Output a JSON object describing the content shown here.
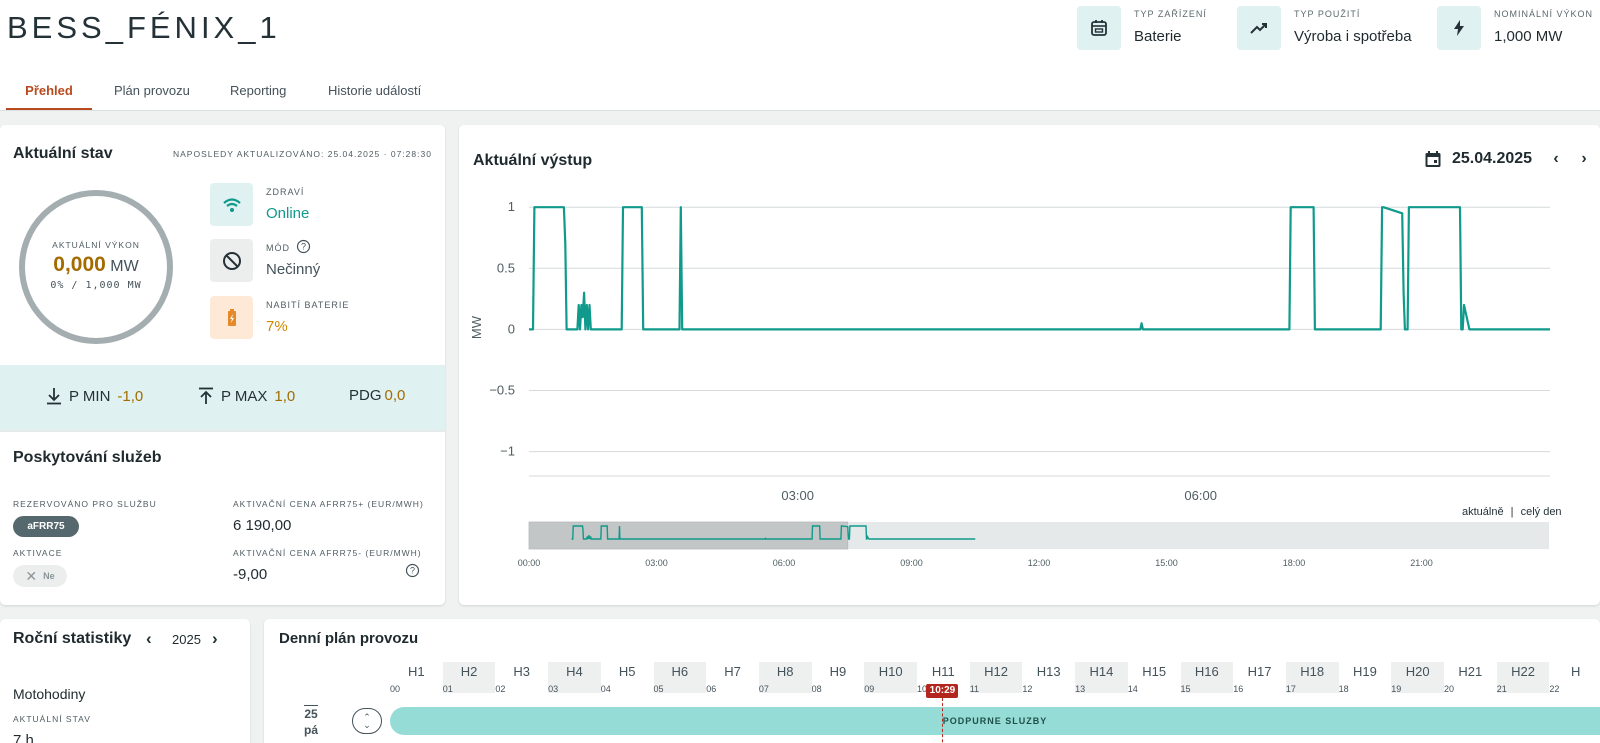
{
  "device": {
    "name": "BESS_FÉNIX_1",
    "info": [
      {
        "label": "TYP ZAŘÍZENÍ",
        "value": "Baterie",
        "icon": "calendar-box-icon"
      },
      {
        "label": "TYP POUŽITÍ",
        "value": "Výroba i spotřeba",
        "icon": "trending-up-icon"
      },
      {
        "label": "NOMINÁLNÍ VÝKON",
        "value": "1,000 MW",
        "icon": "lightning-icon"
      }
    ]
  },
  "tabs": [
    "Přehled",
    "Plán provozu",
    "Reporting",
    "Historie událostí"
  ],
  "active_tab": "Přehled",
  "status": {
    "title": "Aktuální stav",
    "updated": "NAPOSLEDY AKTUALIZOVÁNO: 25.04.2025 · 07:28:30",
    "gauge_label": "AKTUÁLNÍ VÝKON",
    "power_value": "0,000",
    "power_unit": "MW",
    "power_sub": "0% / 1,000 MW",
    "health_label": "ZDRAVÍ",
    "health_value": "Online",
    "mode_label": "MÓD",
    "mode_value": "Nečinný",
    "battery_label": "NABITÍ BATERIE",
    "battery_value": "7%",
    "pmin_label": "P MIN",
    "pmin_value": "-1,0",
    "pmax_label": "P MAX",
    "pmax_value": "1,0",
    "pdg_label": "PDG",
    "pdg_value": "0,0"
  },
  "services": {
    "title": "Poskytování služeb",
    "reserved_label": "REZERVOVÁNO PRO SLUŽBU",
    "reserved_chip": "aFRR75",
    "activation_label": "AKTIVACE",
    "activation_chip": "Ne",
    "price_plus_label": "AKTIVAČNÍ CENA AFRR75+ (EUR/MWH)",
    "price_plus_value": "6 190,00",
    "price_minus_label": "AKTIVAČNÍ CENA AFRR75- (EUR/MWH)",
    "price_minus_value": "-9,00"
  },
  "output": {
    "title": "Aktuální výstup",
    "date": "25.04.2025",
    "view_current": "aktuálně",
    "view_separator": "|",
    "view_full": "celý den"
  },
  "chart_data": {
    "type": "line",
    "title": "Aktuální výstup",
    "ylabel": "MW",
    "ylim": [
      -1.2,
      1.1
    ],
    "y_ticks": [
      "1",
      "0.5",
      "0",
      "−0.5",
      "−1"
    ],
    "y_tick_values": [
      1,
      0.5,
      0,
      -0.5,
      -1
    ],
    "x_ticks": [
      "03:00",
      "06:00"
    ],
    "x_tick_values": [
      3,
      6
    ],
    "xlim": [
      1.0,
      8.6
    ],
    "grid": true,
    "color": "#0f9a8c",
    "series": [
      {
        "x": [
          1.0,
          1.03,
          1.04,
          1.26,
          1.27,
          1.28,
          1.3,
          1.31,
          1.32,
          1.36,
          1.37,
          1.38,
          1.39,
          1.4,
          1.41,
          1.42,
          1.43,
          1.44,
          1.45,
          1.46,
          1.47,
          1.48,
          1.49,
          1.5,
          1.51,
          1.52,
          1.53,
          1.54,
          1.69,
          1.7,
          1.71,
          1.84,
          1.85,
          1.86,
          2.12,
          2.13,
          2.14,
          2.15,
          2.16,
          2.17,
          2.18,
          2.19,
          2.2,
          2.21,
          5.55,
          5.56,
          5.57,
          5.58,
          6.65,
          6.66,
          6.67,
          6.68,
          6.84,
          6.85,
          6.86,
          7.34,
          7.35,
          7.36,
          7.5,
          7.51,
          7.52,
          7.53,
          7.54,
          7.55,
          7.56,
          7.63,
          7.64,
          7.65,
          7.93,
          7.94,
          7.95,
          7.96,
          8.0,
          8.01,
          8.02,
          8.6
        ],
        "y": [
          0,
          0,
          1,
          1,
          0.7,
          0,
          0,
          0,
          0,
          0,
          0.2,
          0,
          0.2,
          0.1,
          0.3,
          0,
          0.2,
          0,
          0.2,
          0,
          0,
          0,
          0,
          0,
          0,
          0,
          0,
          0,
          0,
          1,
          1,
          1,
          0,
          0,
          0,
          1,
          0,
          0,
          0,
          0,
          0,
          0,
          0,
          0,
          0,
          0.05,
          0,
          0,
          0,
          0,
          1,
          1,
          1,
          0,
          0,
          0,
          1,
          1,
          0.95,
          0.3,
          0,
          0,
          0,
          1,
          1,
          1,
          1,
          1,
          1,
          0,
          0,
          0.2,
          0,
          0,
          0,
          0
        ]
      }
    ]
  },
  "navigator": {
    "ticks": [
      "00:00",
      "03:00",
      "06:00",
      "09:00",
      "12:00",
      "15:00",
      "18:00",
      "21:00"
    ],
    "tick_values": [
      0,
      3,
      6,
      9,
      12,
      15,
      18,
      21
    ],
    "window": [
      0,
      7.5
    ],
    "data_end": 10.5
  },
  "yearly": {
    "title": "Roční statistiky",
    "year": "2025",
    "motohours_label": "Motohodiny",
    "current_label": "AKTUÁLNÍ STAV",
    "current_value": "7 h"
  },
  "plan": {
    "title": "Denní plán provozu",
    "hours": [
      "H1",
      "H2",
      "H3",
      "H4",
      "H5",
      "H6",
      "H7",
      "H8",
      "H9",
      "H10",
      "H11",
      "H12",
      "H13",
      "H14",
      "H15",
      "H16",
      "H17",
      "H18",
      "H19",
      "H20",
      "H21",
      "H22",
      "H"
    ],
    "minutes": [
      "00",
      "01",
      "02",
      "03",
      "04",
      "05",
      "06",
      "07",
      "08",
      "09",
      "10",
      "11",
      "12",
      "13",
      "14",
      "15",
      "16",
      "17",
      "18",
      "19",
      "20",
      "21",
      "22"
    ],
    "day_number": "25",
    "day_name": "pá",
    "now_label": "10:29",
    "bar_label": "PODPURNE SLUZBY"
  }
}
